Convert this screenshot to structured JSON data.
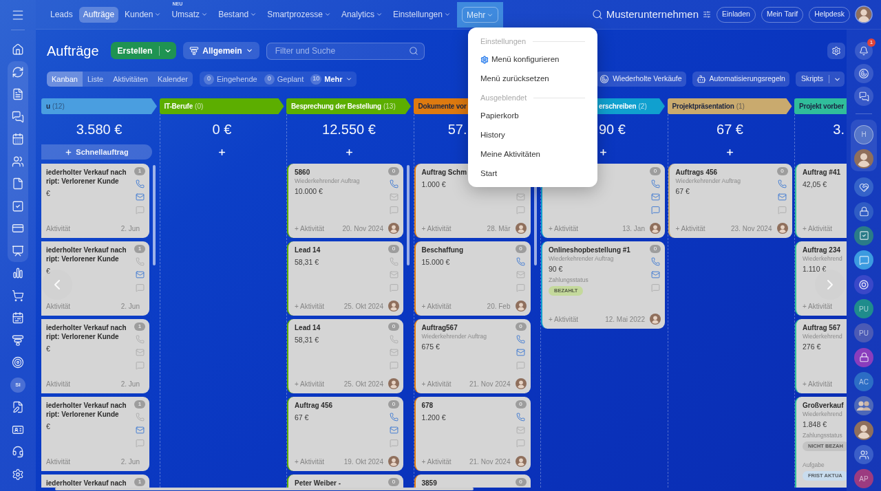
{
  "top_nav": {
    "items": [
      {
        "label": "Leads",
        "selected": false,
        "dropdown": false,
        "open": false
      },
      {
        "label": "Aufträge",
        "selected": true,
        "dropdown": false,
        "open": false
      },
      {
        "label": "Kunden",
        "selected": false,
        "dropdown": true,
        "open": false
      },
      {
        "label": "Umsatz",
        "badge": "NEU",
        "selected": false,
        "dropdown": true,
        "open": false
      },
      {
        "label": "Bestand",
        "selected": false,
        "dropdown": true,
        "open": false
      },
      {
        "label": "Smartprozesse",
        "selected": false,
        "dropdown": true,
        "open": false
      },
      {
        "label": "Analytics",
        "selected": false,
        "dropdown": true,
        "open": false
      },
      {
        "label": "Einstellungen",
        "selected": false,
        "dropdown": true,
        "open": false
      },
      {
        "label": "Mehr",
        "selected": false,
        "dropdown": true,
        "open": true
      }
    ],
    "company": "Musterunternehmen",
    "buttons": [
      "Einladen",
      "Mein Tarif",
      "Helpdesk"
    ]
  },
  "menu": {
    "sections": [
      {
        "title": "Einstellungen",
        "items": [
          {
            "label": "Menü konfigurieren",
            "kind": "settings"
          },
          {
            "label": "Menü zurücksetzen",
            "kind": "plain"
          }
        ]
      },
      {
        "title": "Ausgeblendet",
        "items": [
          {
            "label": "Papierkorb",
            "kind": "plain"
          },
          {
            "label": "History",
            "kind": "plain"
          },
          {
            "label": "Meine Aktivitäten",
            "kind": "plain"
          },
          {
            "label": "Start",
            "kind": "plain"
          }
        ]
      }
    ]
  },
  "left_sidebar": {
    "initials": "SI"
  },
  "toolbar": {
    "title": "Aufträge",
    "create": "Erstellen",
    "filter": "Allgemein",
    "search": {
      "placeholder": "Filter und Suche"
    },
    "views": [
      {
        "label": "Kanban",
        "selected": true
      },
      {
        "label": "Liste",
        "selected": false
      },
      {
        "label": "Aktivitäten",
        "selected": false
      },
      {
        "label": "Kalender",
        "selected": false
      }
    ],
    "counters": [
      {
        "count": "0",
        "label": "Eingehende",
        "dropdown": false
      },
      {
        "count": "0",
        "label": "Geplant",
        "dropdown": false
      },
      {
        "count": "10",
        "label": "Mehr",
        "dropdown": true
      }
    ],
    "actions": [
      {
        "label": "Wiederholte Verkäufe",
        "kind": "button"
      },
      {
        "label": "Automatisierungsregeln",
        "kind": "button"
      },
      {
        "label": "Skripts",
        "kind": "split"
      }
    ]
  },
  "board": {
    "columns": [
      {
        "title": "u",
        "count": "(12)",
        "color": "#4a9ee0",
        "sum": "3.580 €",
        "quick_add": "Schnellauftrag",
        "scrollable": true,
        "cut_start": false,
        "cut_end": false,
        "cards": [
          {
            "title": "iederholter Verkauf nach ript: Verlorener Kunde",
            "amount": "€",
            "count": "1",
            "contacts": {
              "phone": true,
              "mail": true,
              "chat": false
            },
            "activity": "Aktivität",
            "date": "2. Jun",
            "avatar": false
          },
          {
            "title": "iederholter Verkauf nach ript: Verlorener Kunde",
            "amount": "€",
            "count": "1",
            "contacts": {
              "phone": false,
              "mail": true,
              "chat": false
            },
            "activity": "Aktivität",
            "date": "2. Jun",
            "avatar": false
          },
          {
            "title": "iederholter Verkauf nach ript: Verlorener Kunde",
            "amount": "€",
            "count": "1",
            "contacts": {
              "phone": false,
              "mail": false,
              "chat": false
            },
            "activity": "Aktivität",
            "date": "2. Jun",
            "avatar": false
          },
          {
            "title": "iederholter Verkauf nach ript: Verlorener Kunde",
            "amount": "€",
            "count": "1",
            "contacts": {
              "phone": false,
              "mail": true,
              "chat": false
            },
            "activity": "Aktivität",
            "date": "2. Jun",
            "avatar": false
          },
          {
            "title": "iederholter Verkauf nach",
            "count": "1"
          }
        ]
      },
      {
        "title": "IT-Berufe",
        "count": "(0)",
        "color": "#5cae00",
        "sum": "0 €",
        "scrollable": false,
        "cut_start": false,
        "cut_end": false
      },
      {
        "title": "Besprechung der Bestellung",
        "count": "(13)",
        "color": "#5cae00",
        "sum": "12.550 €",
        "scrollable": true,
        "cut_start": false,
        "cut_end": false,
        "cards": [
          {
            "title": "5860",
            "subtitle": "Wiederkehrender Auftrag",
            "amount": "10.000 €",
            "count": "0",
            "contacts": {
              "phone": true,
              "mail": false,
              "chat": false
            },
            "activity": "+ Aktivität",
            "date": "20. Nov 2024",
            "avatar": true
          },
          {
            "title": "Lead 14",
            "amount": "58,31 €",
            "count": "0",
            "contacts": {
              "phone": false,
              "mail": false,
              "chat": false
            },
            "activity": "+ Aktivität",
            "date": "25. Okt 2024",
            "avatar": true
          },
          {
            "title": "Lead 14",
            "amount": "58,31 €",
            "count": "0",
            "contacts": {
              "phone": false,
              "mail": false,
              "chat": false
            },
            "activity": "+ Aktivität",
            "date": "25. Okt 2024",
            "avatar": true
          },
          {
            "title": "Auftrag 456",
            "amount": "67 €",
            "count": "0",
            "contacts": {
              "phone": true,
              "mail": true,
              "chat": false
            },
            "activity": "+ Aktivität",
            "date": "19. Okt 2024",
            "avatar": true
          },
          {
            "title": "Peter Weiber -",
            "count": "0"
          }
        ]
      },
      {
        "title": "Dokumente vor",
        "color": "#de7a10",
        "sum": "57.",
        "scrollable": true,
        "cut_start": false,
        "cut_end": true,
        "cards": [
          {
            "title": "Auftrag Schm",
            "amount": "1.000 €",
            "contacts": {
              "mail": false,
              "chat": false
            },
            "activity": "+ Aktivität",
            "date": "28. Mär",
            "avatar": true
          },
          {
            "title": "Beschaffung",
            "amount": "15.000 €",
            "count": "0",
            "contacts": {
              "phone": true,
              "mail": false,
              "chat": false
            },
            "activity": "+ Aktivität",
            "date": "20. Feb",
            "avatar": true
          },
          {
            "title": "Auftrag567",
            "subtitle": "Wiederkehrender Auftrag",
            "amount": "675 €",
            "count": "0",
            "contacts": {
              "phone": true,
              "mail": true,
              "chat": false
            },
            "activity": "+ Aktivität",
            "date": "21. Nov 2024",
            "avatar": true
          },
          {
            "title": "678",
            "amount": "1.200 €",
            "count": "0",
            "contacts": {
              "phone": true,
              "mail": false,
              "chat": false
            },
            "activity": "+ Aktivität",
            "date": "21. Nov 2024",
            "avatar": true
          },
          {
            "title": "3859",
            "count": "0"
          }
        ]
      },
      {
        "title": "erschreiben",
        "count": "(2)",
        "color": "#10a0cf",
        "sum": "90 €",
        "scrollable": false,
        "cut_start": true,
        "cut_end": false,
        "cards": [
          {
            "count": "0",
            "contacts": {
              "phone": true,
              "mail": true,
              "chat": true
            },
            "activity": "+ Aktivität",
            "date": "13. Jan",
            "avatar": true
          },
          {
            "title": "Onlineshopbestellung #1",
            "subtitle": "Wiederkehrender Auftrag",
            "amount": "90 €",
            "fields": [
              {
                "label": "Zahlungsstatus",
                "tag": "BEZAHLT",
                "color": "#c4d99c"
              }
            ],
            "count": "0",
            "contacts": {
              "phone": true,
              "mail": true,
              "chat": false
            },
            "activity": "+ Aktivität",
            "date": "12. Mai 2022",
            "avatar": true
          }
        ]
      },
      {
        "title": "Projektpräsentation",
        "count": "(1)",
        "color": "#c9aa6e",
        "sum": "67 €",
        "scrollable": false,
        "cut_start": false,
        "cut_end": false,
        "cards": [
          {
            "title": "Auftrags 456",
            "subtitle": "Wiederkehrender Auftrag",
            "amount": "67 €",
            "count": "0",
            "contacts": {
              "phone": true,
              "mail": true,
              "chat": false
            },
            "activity": "+ Aktivität",
            "date": "23. Nov 2024",
            "avatar": true
          }
        ]
      },
      {
        "title": "Projekt vorber",
        "color": "#30bd9b",
        "sum": "3.",
        "scrollable": false,
        "cut_start": false,
        "cards": [
          {
            "title": "Auftrag #41",
            "amount": "42,05 €",
            "activity": "+ Aktivität",
            "avatar": false
          },
          {
            "title": "Auftrag 234",
            "subtitle": "Wiederkehrend",
            "amount": "1.110 €",
            "activity": "+ Aktivität",
            "avatar": false
          },
          {
            "title": "Auftrag 567",
            "subtitle": "Wiederkehrend",
            "amount": "276 €",
            "activity": "+ Aktivität",
            "avatar": false
          },
          {
            "title": "Großverkauf",
            "subtitle": "Wiederkehrend",
            "amount": "1.848 €",
            "fields": [
              {
                "label": "Zahlungsstatus",
                "tag": "NICHT BEZAH",
                "color": "#c3c3c3"
              },
              {
                "label": "Aufgabe",
                "tag": "FRIST AKTUA",
                "color": "#c8dcee"
              }
            ]
          }
        ]
      }
    ]
  },
  "right_sidebar": {
    "notifications": "1",
    "chips": [
      {
        "initials": "H",
        "color": "#5676c9"
      },
      {
        "initials": "PU",
        "color": "#1f8c8c"
      },
      {
        "initials": "PU",
        "color": "#4b5ab5"
      },
      {
        "initials": "AC",
        "color": "#2c6dc5"
      },
      {
        "initials": "AP",
        "color": "#9c3b80"
      }
    ]
  }
}
